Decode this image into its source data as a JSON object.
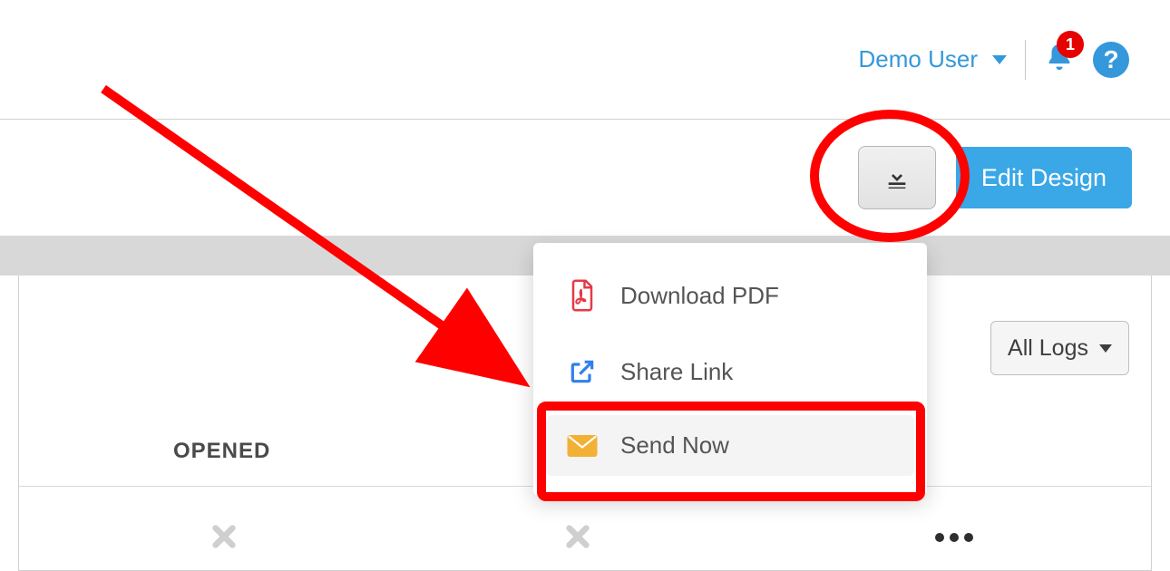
{
  "header": {
    "user_name": "Demo User",
    "notification_count": "1",
    "help_symbol": "?"
  },
  "toolbar": {
    "edit_label": "Edit Design",
    "download_icon": "download-icon"
  },
  "logs_dropdown": {
    "label": "All Logs"
  },
  "columns": {
    "opened_label": "OPENED"
  },
  "menu": {
    "items": [
      {
        "label": "Download PDF",
        "icon": "pdf-icon",
        "color": "#e63946"
      },
      {
        "label": "Share Link",
        "icon": "external-link-icon",
        "color": "#2f80ed"
      },
      {
        "label": "Send Now",
        "icon": "mail-icon",
        "color": "#f2b134"
      }
    ]
  },
  "annotation": {
    "highlight_circle": true,
    "highlight_rect": true,
    "arrow": true
  }
}
